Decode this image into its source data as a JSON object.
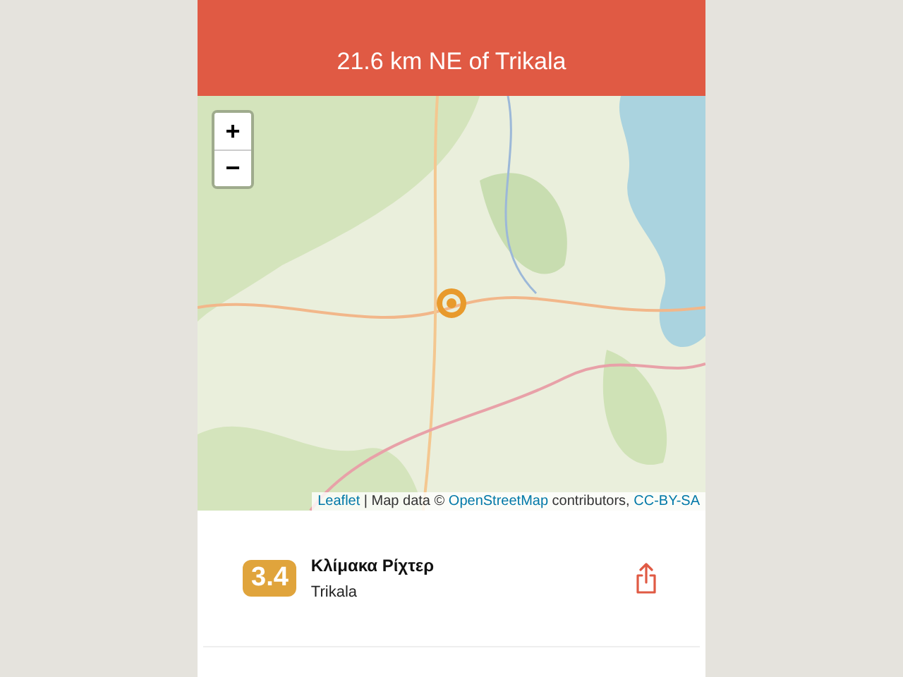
{
  "header": {
    "subtitle": "21.6 km NE of Trikala"
  },
  "map": {
    "kind": "picture",
    "zoom_in": "+",
    "zoom_out": "−",
    "attribution": [
      {
        "kind": "link",
        "text": "Leaflet"
      },
      {
        "kind": "text",
        "text": " | Map data © "
      },
      {
        "kind": "link",
        "text": "OpenStreetMap"
      },
      {
        "kind": "text",
        "text": " contributors, "
      },
      {
        "kind": "link",
        "text": "CC-BY-SA"
      }
    ]
  },
  "quake": {
    "magnitude": "3.4",
    "scale": "Κλίμακα Ρίχτερ",
    "place": "Trikala"
  }
}
